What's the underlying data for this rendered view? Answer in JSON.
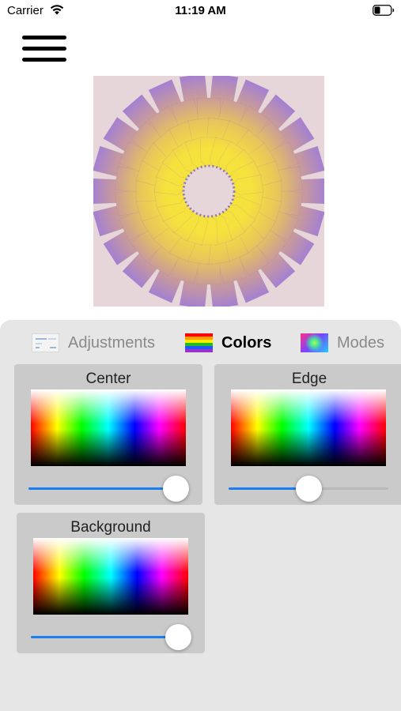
{
  "status_bar": {
    "carrier": "Carrier",
    "time": "11:19 AM",
    "wifi_icon": "wifi-icon",
    "battery_icon": "battery-icon"
  },
  "menu": {
    "icon": "hamburger-menu-icon"
  },
  "preview": {
    "description_colors": {
      "center": "#f5df3c",
      "edge": "#a67fd0",
      "background": "#e6d6da"
    },
    "petal_rings": 4
  },
  "tabs": [
    {
      "label": "Adjustments",
      "icon": "adjustments-icon",
      "active": false
    },
    {
      "label": "Colors",
      "icon": "rainbow-flag-icon",
      "active": true
    },
    {
      "label": "Modes",
      "icon": "modes-gradient-icon",
      "active": false
    }
  ],
  "color_cards": {
    "center": {
      "title": "Center",
      "slider_value": 0.92
    },
    "edge": {
      "title": "Edge",
      "slider_value": 0.5
    },
    "background": {
      "title": "Background",
      "slider_value": 0.92
    }
  },
  "colors": {
    "accent": "#1a7ef0",
    "panel": "#e6e6e6",
    "card": "#cacaca"
  }
}
